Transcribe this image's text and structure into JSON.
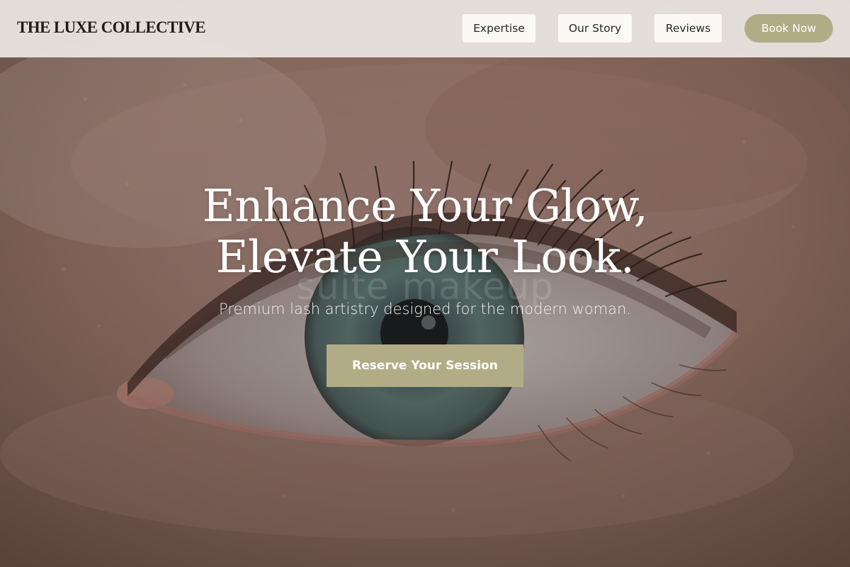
{
  "brand": {
    "name": "THE LUXE COLLECTIVE"
  },
  "nav": {
    "items": [
      {
        "label": "Expertise"
      },
      {
        "label": "Our Story"
      },
      {
        "label": "Reviews"
      }
    ],
    "book_label": "Book Now"
  },
  "hero": {
    "headline_line1": "Enhance Your Glow,",
    "headline_line2": "Elevate Your Look.",
    "watermark": "suite makeup",
    "subtitle": "Premium lash artistry designed for the modern woman.",
    "cta_label": "Reserve Your Session"
  },
  "colors": {
    "accent": "#b2ac86",
    "header_bg": "#ece7e4",
    "nav_button_bg": "#faf9f5",
    "text_dark": "#1f1d1c"
  }
}
